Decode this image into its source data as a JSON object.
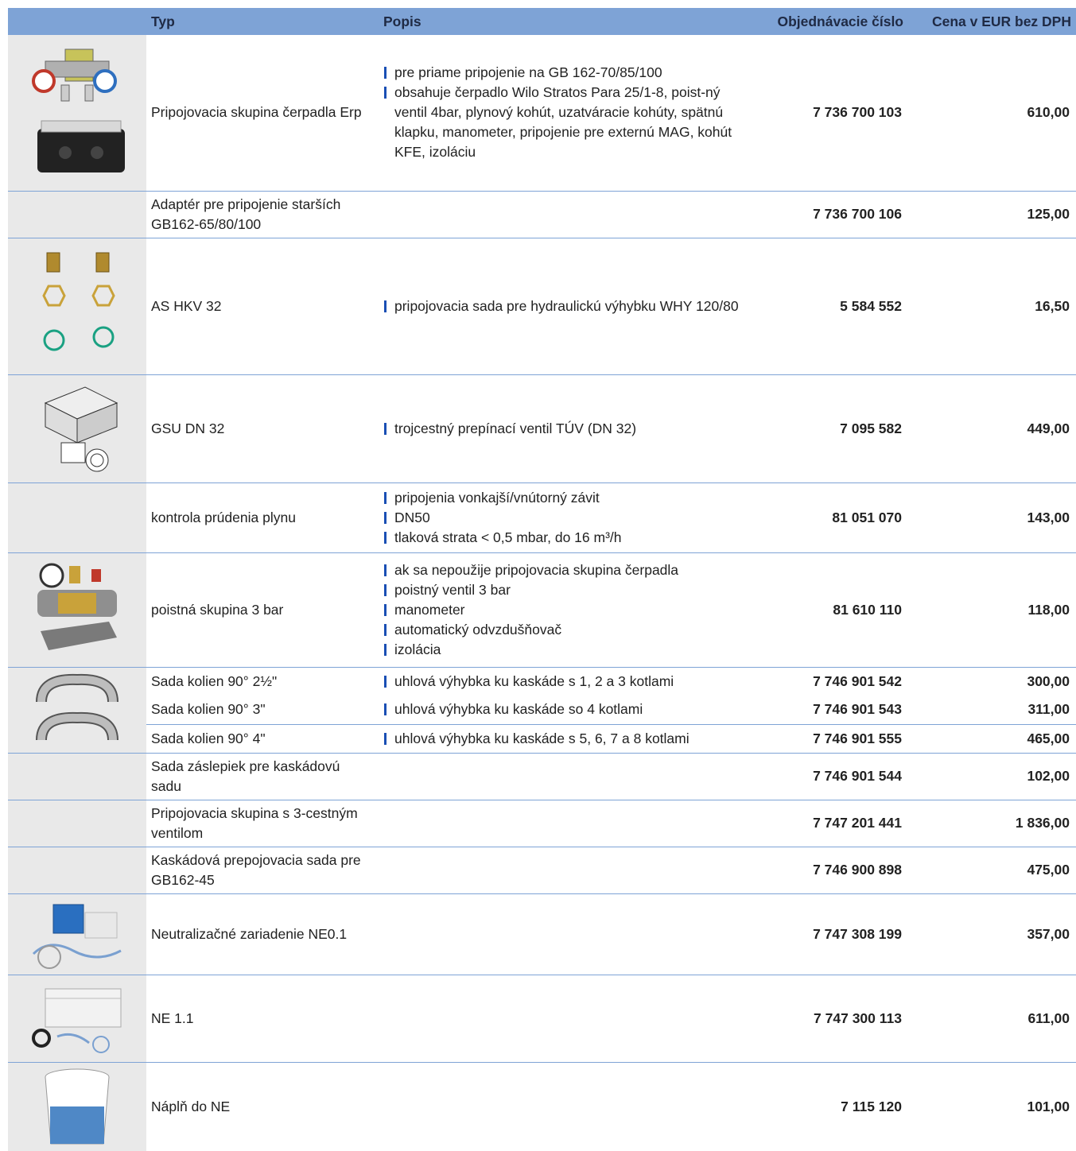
{
  "header": {
    "typ": "Typ",
    "popis": "Popis",
    "objednavacie_cislo": "Objednávacie číslo",
    "cena": "Cena v EUR bez DPH"
  },
  "rows": [
    {
      "typ": "Pripojovacia skupina čerpadla Erp",
      "popis": [
        "pre priame pripojenie na GB 162-70/85/100",
        "obsahuje čerpadlo Wilo Stratos Para 25/1-8, poist-ný ventil 4bar, plynový kohút, uzatváracie kohúty, spätnú klapku, manometer, pripojenie pre externú MAG, kohút KFE, izoláciu"
      ],
      "cislo": "7 736 700 103",
      "cena": "610,00",
      "icon": "pump-group-icon"
    },
    {
      "typ": "Adaptér pre pripojenie starších GB162-65/80/100",
      "popis": [],
      "cislo": "7 736 700 106",
      "cena": "125,00"
    },
    {
      "typ": "AS HKV 32",
      "popis": [
        "pripojovacia sada pre hydraulickú výhybku WHY 120/80"
      ],
      "cislo": "5 584 552",
      "cena": "16,50",
      "icon": "fittings-set-icon"
    },
    {
      "typ": "GSU DN 32",
      "popis": [
        "trojcestný prepínací ventil TÚV (DN 32)"
      ],
      "cislo": "7 095 582",
      "cena": "449,00",
      "icon": "three-way-valve-icon"
    },
    {
      "typ": "kontrola prúdenia plynu",
      "popis": [
        "pripojenia vonkajší/vnútorný závit",
        "DN50",
        "tlaková strata < 0,5 mbar, do 16 m³/h"
      ],
      "cislo": "81 051 070",
      "cena": "143,00"
    },
    {
      "typ": "poistná skupina 3 bar",
      "popis": [
        "ak sa nepoužije pripojovacia skupina čerpadla",
        "poistný ventil 3 bar",
        "manometer",
        "automatický odvzdušňovač",
        "izolácia"
      ],
      "cislo": "81 610 110",
      "cena": "118,00",
      "icon": "safety-group-icon"
    },
    {
      "typ": "Sada kolien 90° 2½\"",
      "popis": [
        "uhlová výhybka ku kaskáde s 1, 2 a 3 kotlami"
      ],
      "cislo": "7 746 901 542",
      "cena": "300,00",
      "icon": "elbow-set-icon"
    },
    {
      "typ": "Sada kolien 90° 3\"",
      "popis": [
        "uhlová výhybka ku kaskáde so 4 kotlami"
      ],
      "cislo": "7 746 901 543",
      "cena": "311,00"
    },
    {
      "typ": "Sada kolien 90° 4\"",
      "popis": [
        "uhlová výhybka ku kaskáde s 5, 6, 7 a 8 kotlami"
      ],
      "cislo": "7 746 901 555",
      "cena": "465,00"
    },
    {
      "typ": "Sada záslepiek pre kaskádovú sadu",
      "popis": [],
      "cislo": "7 746 901 544",
      "cena": "102,00"
    },
    {
      "typ": "Pripojovacia skupina s 3-cestným ventilom",
      "popis": [],
      "cislo": "7 747 201 441",
      "cena": "1 836,00"
    },
    {
      "typ": "Kaskádová prepojovacia sada pre GB162-45",
      "popis": [],
      "cislo": "7 746 900 898",
      "cena": "475,00"
    },
    {
      "typ": "Neutralizačné zariadenie NE0.1",
      "popis": [],
      "cislo": "7 747 308 199",
      "cena": "357,00",
      "icon": "neutralization-box-icon"
    },
    {
      "typ": "NE 1.1",
      "popis": [],
      "cislo": "7 747 300 113",
      "cena": "611,00",
      "icon": "neutralization-tank-icon"
    },
    {
      "typ": "Náplň do NE",
      "popis": [],
      "cislo": "7 115 120",
      "cena": "101,00",
      "icon": "refill-bucket-icon"
    }
  ],
  "colors": {
    "header_bg": "#7ea3d6",
    "bullet": "#1a4fb4",
    "image_bg": "#e9e9e9"
  }
}
